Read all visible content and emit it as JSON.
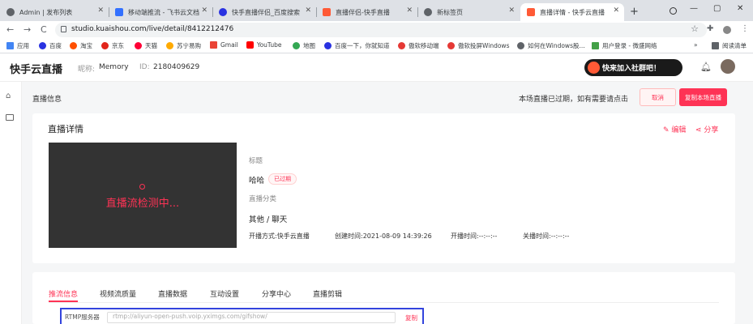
{
  "browser": {
    "tabs": [
      {
        "title": "Admin | 发布列表",
        "fav_color": "#5f6368"
      },
      {
        "title": "移动端推流 - 飞书云文档",
        "fav_color": "#3370ff"
      },
      {
        "title": "快手直播伴侣_百度搜索",
        "fav_color": "#2932e1"
      },
      {
        "title": "直播伴侣-快手直播",
        "fav_color": "#ff5a36"
      },
      {
        "title": "新标签页",
        "fav_color": "#5f6368"
      },
      {
        "title": "直播详情 - 快手云直播",
        "fav_color": "#ff5a36"
      }
    ],
    "new_tab": "+",
    "win_min": "—",
    "win_max": "▢",
    "win_close": "✕",
    "back": "←",
    "forward": "→",
    "reload": "C",
    "url": "studio.kuaishou.com/live/detail/8412212476",
    "bookmarks": [
      {
        "label": "应用",
        "color": "#4285f4"
      },
      {
        "label": "百度",
        "color": "#2932e1"
      },
      {
        "label": "淘宝",
        "color": "#ff5000"
      },
      {
        "label": "京东",
        "color": "#e1251b"
      },
      {
        "label": "天猫",
        "color": "#ff0036"
      },
      {
        "label": "苏宁易购",
        "color": "#ffaa00"
      },
      {
        "label": "Gmail",
        "color": "#ea4335"
      },
      {
        "label": "YouTube",
        "color": "#ff0000"
      },
      {
        "label": "地图",
        "color": "#34a853"
      },
      {
        "label": "百度一下，你就知道",
        "color": "#2932e1"
      },
      {
        "label": "傲软移动端",
        "color": "#e53935"
      },
      {
        "label": "傲软投屏Windows",
        "color": "#e53935"
      },
      {
        "label": "如何在Windows股...",
        "color": "#5f6368"
      },
      {
        "label": "用户登录 - 微盛网络",
        "color": "#43a047"
      },
      {
        "label": "阅读清单",
        "color": "#5f6368"
      }
    ],
    "bookmarks_more": "»"
  },
  "app": {
    "logo": "快手云直播",
    "nickname_label": "昵称:",
    "nickname": "Memory",
    "id_label": "ID:",
    "id": "2180409629",
    "promo": "快来加入社群吧！"
  },
  "infobar": {
    "title": "直播信息",
    "message": "本场直播已过期，如有需要请点击",
    "cancel": "取消",
    "copy": "复制本场直播"
  },
  "detail": {
    "title": "直播详情",
    "edit": "编辑",
    "share": "分享",
    "player_text": "直播流检测中...",
    "title_label": "标题",
    "title_value": "哈哈",
    "status_badge": "已过期",
    "category_label": "直播分类",
    "category_value": "其他 / 聊天",
    "start_method_label": "开播方式:",
    "start_method": "快手云直播",
    "created_label": "创建时间:",
    "created": "2021-08-09 14:39:26",
    "start_label": "开播时间:",
    "start": "--:--:--",
    "end_label": "关播时间:",
    "end": "--:--:--"
  },
  "tabs2": {
    "items": [
      "推流信息",
      "视频流质量",
      "直播数据",
      "互动设置",
      "分享中心",
      "直播剪辑"
    ],
    "rtmp_label": "RTMP服务器",
    "rtmp_value": "rtmp://aliyun-open-push.voip.yximgs.com/gifshow/",
    "rtmp_copy": "复制"
  },
  "colors": {
    "accent": "#fe3355",
    "highlight": "#3344dd"
  }
}
